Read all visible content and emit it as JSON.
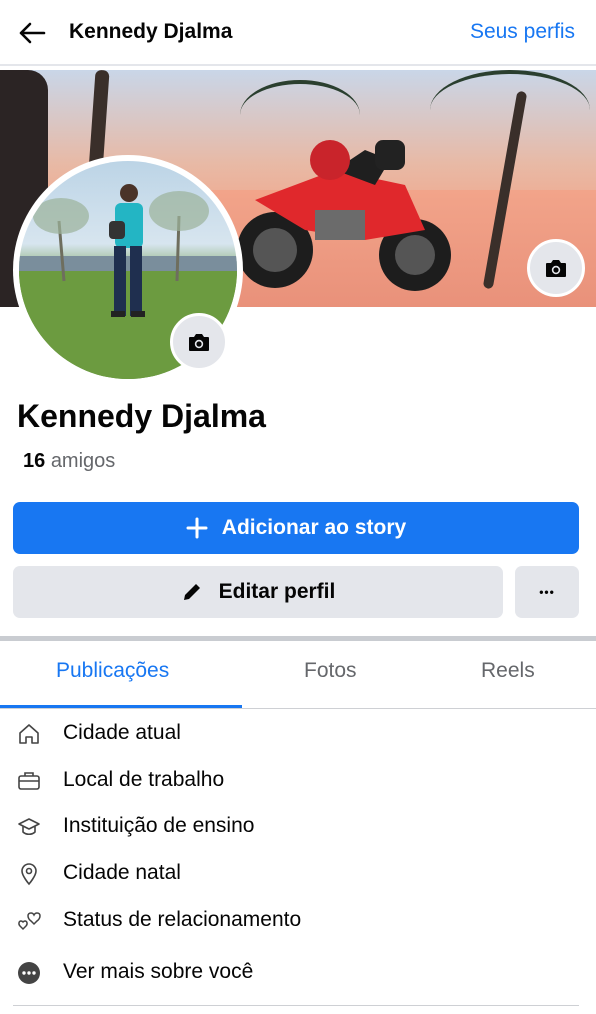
{
  "header": {
    "title": "Kennedy Djalma",
    "profiles_link": "Seus perfis",
    "back_icon": "arrow-left-icon"
  },
  "profile": {
    "name": "Kennedy Djalma",
    "friends_count": "16",
    "friends_label": "amigos"
  },
  "actions": {
    "add_story": "Adicionar ao story",
    "edit_profile": "Editar perfil",
    "more": "•••"
  },
  "tabs": [
    {
      "label": "Publicações",
      "active": true
    },
    {
      "label": "Fotos",
      "active": false
    },
    {
      "label": "Reels",
      "active": false
    }
  ],
  "details": [
    {
      "icon": "home-icon",
      "label": "Cidade atual"
    },
    {
      "icon": "briefcase-icon",
      "label": "Local de trabalho"
    },
    {
      "icon": "graduation-cap-icon",
      "label": "Instituição de ensino"
    },
    {
      "icon": "location-pin-icon",
      "label": "Cidade natal"
    },
    {
      "icon": "hearts-icon",
      "label": "Status de relacionamento"
    },
    {
      "icon": "more-circle-icon",
      "label": "Ver mais sobre você"
    }
  ],
  "colors": {
    "accent": "#1877f2",
    "button_gray": "#e4e6eb",
    "muted_text": "#65676b"
  }
}
